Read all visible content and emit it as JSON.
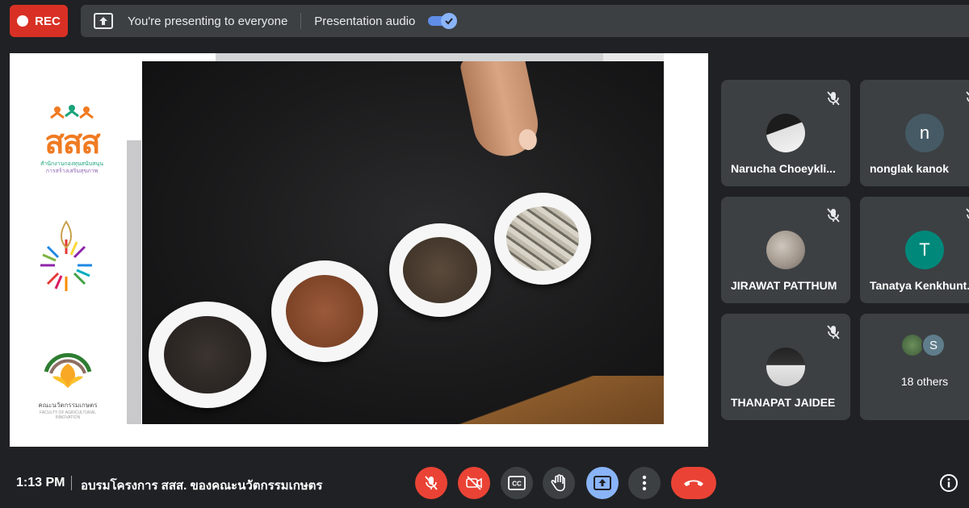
{
  "top_bar": {
    "rec_label": "REC",
    "presenting_text": "You're presenting to everyone",
    "audio_label": "Presentation audio",
    "audio_enabled": true
  },
  "slide": {
    "logo1_text": "สสส",
    "logo1_sub": "สำนักงานกองทุนสนับสนุน",
    "logo1_sub2": "การสร้างเสริมสุขภาพ",
    "logo3_text": "คณะนวัตกรรมเกษตร",
    "logo3_sub": "FACULTY OF AGRICULTURAL INNOVATION"
  },
  "participants": [
    {
      "name": "Narucha Choeykli...",
      "muted": true,
      "avatar_type": "photo"
    },
    {
      "name": "nonglak kanok",
      "muted": true,
      "avatar_type": "letter",
      "initial": "n",
      "color": "#455a64"
    },
    {
      "name": "JIRAWAT PATTHUM",
      "muted": true,
      "avatar_type": "photo"
    },
    {
      "name": "Tanatya Kenkhunt...",
      "muted": true,
      "avatar_type": "letter",
      "initial": "T",
      "color": "#00897b"
    },
    {
      "name": "THANAPAT JAIDEE",
      "muted": true,
      "avatar_type": "photo"
    },
    {
      "name": "18 others",
      "initial": "S",
      "color": "#607d8b"
    }
  ],
  "bottom_bar": {
    "time": "1:13 PM",
    "meeting_title": "อบรมโครงการ สสส. ของคณะนวัตกรรมเกษตร"
  },
  "colors": {
    "background": "#202124",
    "tile": "#3c4043",
    "danger": "#ea4335",
    "accent": "#8ab4f8"
  }
}
